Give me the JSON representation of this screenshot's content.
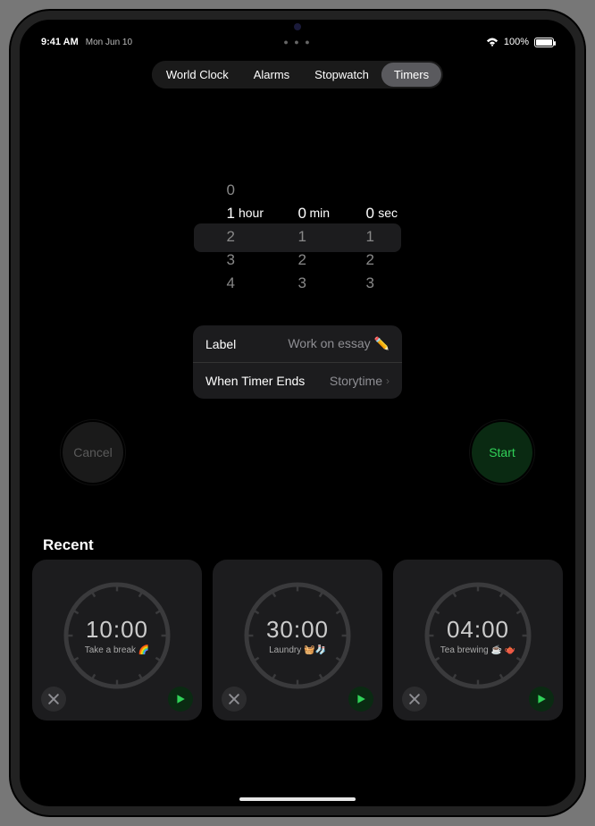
{
  "status": {
    "time": "9:41 AM",
    "date": "Mon Jun 10",
    "battery_pct": "100%"
  },
  "nav": {
    "tabs": [
      "World Clock",
      "Alarms",
      "Stopwatch",
      "Timers"
    ],
    "active_index": 3
  },
  "picker": {
    "hours_selected": "1",
    "hours_unit": "hour",
    "minutes_selected": "0",
    "minutes_unit": "min",
    "seconds_selected": "0",
    "seconds_unit": "sec",
    "hours_ctx": [
      "0",
      "1",
      "2",
      "3",
      "4"
    ],
    "minutes_ctx": [
      "",
      "0",
      "1",
      "2",
      "3"
    ],
    "seconds_ctx": [
      "",
      "0",
      "1",
      "2",
      "3"
    ]
  },
  "settings": {
    "label_key": "Label",
    "label_value": "Work on essay ✏️",
    "ends_key": "When Timer Ends",
    "ends_value": "Storytime"
  },
  "buttons": {
    "cancel": "Cancel",
    "start": "Start"
  },
  "recent": {
    "header": "Recent",
    "cards": [
      {
        "time": "10:00",
        "caption": "Take a break 🌈"
      },
      {
        "time": "30:00",
        "caption": "Laundry 🧺🧦"
      },
      {
        "time": "04:00",
        "caption": "Tea brewing ☕️ 🫖"
      }
    ]
  }
}
